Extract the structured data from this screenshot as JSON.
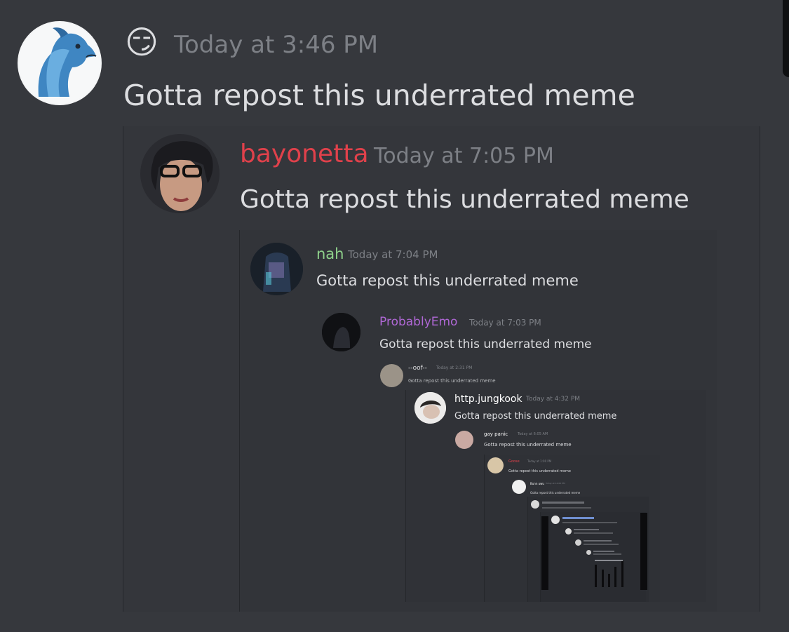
{
  "top_message": {
    "emoji": "😏",
    "timestamp": "Today at 3:46 PM",
    "text": "Gotta repost this underrated meme",
    "avatar_icon": "dragon-avatar-icon"
  },
  "quotes": [
    {
      "username": "bayonetta",
      "timestamp": "Today at 7:05 PM",
      "text": "Gotta repost this underrated meme",
      "name_color": "#e0414b"
    },
    {
      "username": "nah",
      "timestamp": "Today at 7:04 PM",
      "text": "Gotta repost this underrated meme",
      "name_color": "#8fd18b"
    },
    {
      "username": "ProbablyEmo",
      "timestamp": "Today at 7:03 PM",
      "text": "Gotta repost this underrated meme",
      "name_color": "#b068d6"
    },
    {
      "username": "--oof--",
      "timestamp": "Today at 2:31 PM",
      "text": "Gotta repost this underrated meme",
      "name_color": "#dcdde0"
    },
    {
      "username": "http.jungkook",
      "timestamp": "Today at 4:32 PM",
      "text": "Gotta repost this underrated meme",
      "name_color": "#ffffff"
    },
    {
      "username": "gay panic",
      "timestamp": "Today at 6:05 AM",
      "text": "Gotta repost this underrated meme",
      "name_color": "#ffffff"
    },
    {
      "username": "Goose",
      "timestamp": "Today at 1:00 PM",
      "text": "Gotta repost this underrated meme",
      "name_color": "#e0414b"
    },
    {
      "username": "Bunn uwu",
      "timestamp": "Today at 12:00 PM",
      "text": "Gotta repost this underrated meme",
      "name_color": "#ffffff"
    }
  ],
  "colors": {
    "background": "#36383d",
    "timestamp": "#7d8086",
    "text": "#dcdde0"
  }
}
